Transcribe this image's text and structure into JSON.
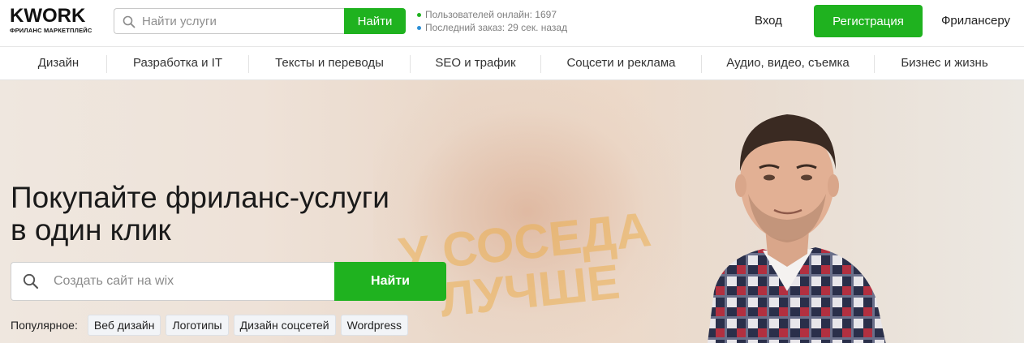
{
  "header": {
    "logo_word": "KWORK",
    "logo_sub": "ФРИЛАНС МАРКЕТПЛЕЙС",
    "search_placeholder": "Найти услуги",
    "search_button": "Найти",
    "stats": [
      {
        "text": "Пользователей онлайн: 1697",
        "color": "#1fb21f"
      },
      {
        "text": "Последний заказ: 29 сек. назад",
        "color": "#2b8fd6"
      }
    ],
    "login": "Вход",
    "register": "Регистрация",
    "freelancer": "Фрилансеру"
  },
  "categories": [
    "Дизайн",
    "Разработка и IT",
    "Тексты и переводы",
    "SEO и трафик",
    "Соцсети и реклама",
    "Аудио, видео, съемка",
    "Бизнес и жизнь"
  ],
  "hero": {
    "title_line1": "Покупайте фриланс-услуги",
    "title_line2": "в один клик",
    "search_placeholder": "Создать сайт на wix",
    "search_button": "Найти",
    "sign_line1": "У СОСЕДА",
    "sign_line2": "ЛУЧШЕ",
    "popular_label": "Популярное:",
    "popular_tags": [
      "Веб дизайн",
      "Логотипы",
      "Дизайн соцсетей",
      "Wordpress"
    ]
  },
  "colors": {
    "accent_green": "#1fb21f",
    "dot_blue": "#2b8fd6"
  }
}
